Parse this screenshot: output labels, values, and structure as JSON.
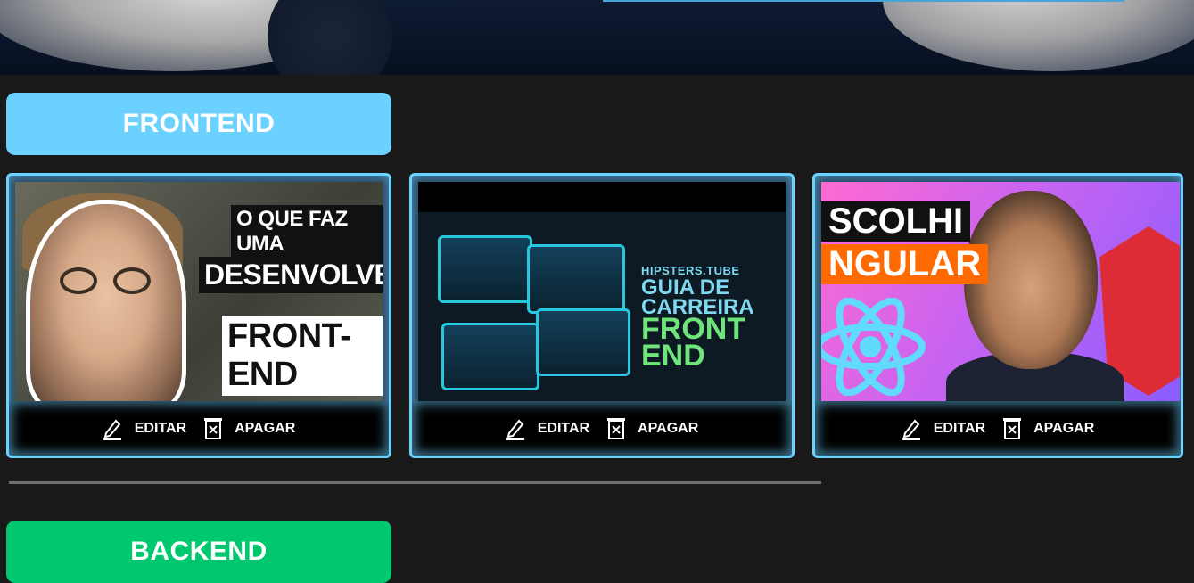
{
  "categories": {
    "frontend": {
      "label": "FRONTEND",
      "color": "#6BD1FF"
    },
    "backend": {
      "label": "BACKEND",
      "color": "#00C86F"
    }
  },
  "cards": [
    {
      "thumb_text": [
        "O QUE FAZ UMA",
        "DESENVOLVEDOR",
        "FRONT-END"
      ],
      "edit_label": "EDITAR",
      "delete_label": "APAGAR"
    },
    {
      "thumb_text": [
        "HIPSTERS.TUBE",
        "GUIA DE CARREIRA",
        "FRONT END"
      ],
      "edit_label": "EDITAR",
      "delete_label": "APAGAR"
    },
    {
      "thumb_text": [
        "SCOLHI",
        "NGULAR"
      ],
      "edit_label": "EDITAR",
      "delete_label": "APAGAR"
    }
  ],
  "icons": {
    "edit": "pencil-icon",
    "delete": "trash-icon"
  }
}
